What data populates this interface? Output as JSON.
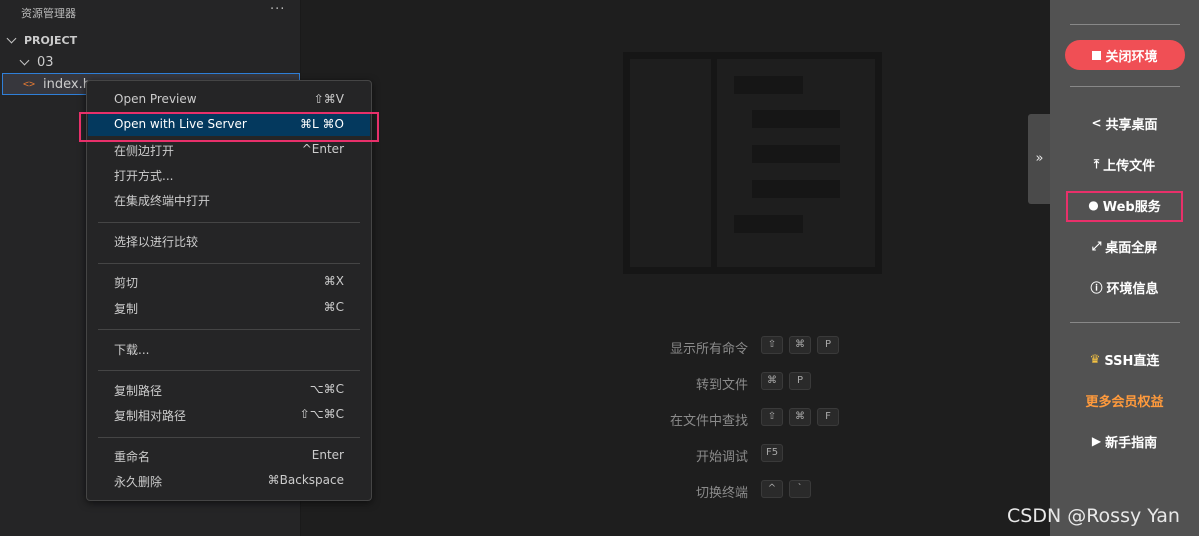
{
  "sidebar": {
    "title": "资源管理器",
    "more": "···",
    "project": "PROJECT",
    "folder": "03",
    "file": "index.h"
  },
  "context_menu": {
    "items": [
      {
        "label": "Open Preview",
        "shortcut": "⇧⌘V"
      },
      {
        "label": "Open with Live Server",
        "shortcut": "⌘L ⌘O"
      },
      {
        "label": "在侧边打开",
        "shortcut": "^Enter"
      },
      {
        "label": "打开方式...",
        "shortcut": ""
      },
      {
        "label": "在集成终端中打开",
        "shortcut": ""
      },
      {
        "label": "选择以进行比较",
        "shortcut": ""
      },
      {
        "label": "剪切",
        "shortcut": "⌘X"
      },
      {
        "label": "复制",
        "shortcut": "⌘C"
      },
      {
        "label": "下载...",
        "shortcut": ""
      },
      {
        "label": "复制路径",
        "shortcut": "⌥⌘C"
      },
      {
        "label": "复制相对路径",
        "shortcut": "⇧⌥⌘C"
      },
      {
        "label": "重命名",
        "shortcut": "Enter"
      },
      {
        "label": "永久删除",
        "shortcut": "⌘Backspace"
      }
    ]
  },
  "editor": {
    "shortcuts": [
      {
        "label": "显示所有命令",
        "keys": [
          "⇧",
          "⌘",
          "P"
        ]
      },
      {
        "label": "转到文件",
        "keys": [
          "⌘",
          "P"
        ]
      },
      {
        "label": "在文件中查找",
        "keys": [
          "⇧",
          "⌘",
          "F"
        ]
      },
      {
        "label": "开始调试",
        "keys": [
          "F5"
        ]
      },
      {
        "label": "切换终端",
        "keys": [
          "^",
          "`"
        ]
      }
    ]
  },
  "right_panel": {
    "collapse": "»",
    "close_env": "关闭环境",
    "share_desktop": "共享桌面",
    "upload_file": "上传文件",
    "web_service": "Web服务",
    "fullscreen": "桌面全屏",
    "env_info": "环境信息",
    "ssh": "SSH直连",
    "member_benefits": "更多会员权益",
    "guide": "新手指南"
  },
  "watermark": "CSDN @Rossy Yan",
  "colors": {
    "close_button": "#f04f55",
    "highlight_box": "#e8306a",
    "selected_item": "#04395e",
    "benefits_text": "#ff9a3c"
  }
}
